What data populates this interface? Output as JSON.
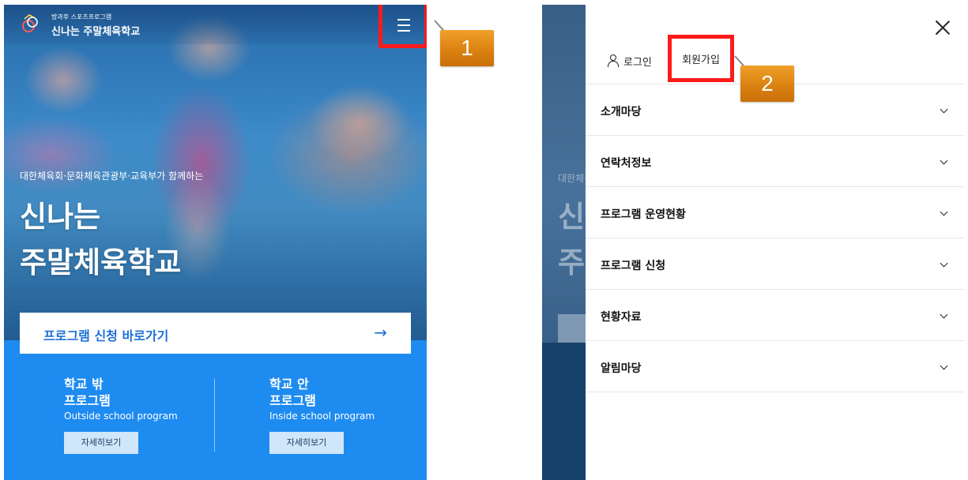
{
  "left": {
    "header": {
      "logo_small": "방과후 스포츠프로그램",
      "logo_title": "신나는 주말체육학교"
    },
    "hero": {
      "subtitle": "대한체육회·문화체육관광부·교육부가 함께하는",
      "title_line1": "신나는",
      "title_line2": "주말체육학교"
    },
    "apply_bar": {
      "label": "프로그램 신청 바로가기",
      "arrow": "→"
    },
    "programs": [
      {
        "title_line1": "학교 밖",
        "title_line2": "프로그램",
        "english": "Outside school program",
        "button": "자세히보기"
      },
      {
        "title_line1": "학교 안",
        "title_line2": "프로그램",
        "english": "Inside school program",
        "button": "자세히보기"
      }
    ]
  },
  "callouts": {
    "one": "1",
    "two": "2"
  },
  "right": {
    "ghost_subtitle": "대한체육회",
    "ghost_title_line1": "신나",
    "ghost_title_line2": "주말",
    "login": "로그인",
    "signup": "회원가입",
    "menu": [
      {
        "label": "소개마당"
      },
      {
        "label": "연락처정보"
      },
      {
        "label": "프로그램 운영현황"
      },
      {
        "label": "프로그램 신청"
      },
      {
        "label": "현황자료"
      },
      {
        "label": "알림마당"
      }
    ]
  },
  "colors": {
    "accent_blue": "#1e8bf0",
    "highlight_red": "#ff1a1a",
    "callout_orange": "#e08a18"
  },
  "icons": {
    "menu": "hamburger-icon",
    "close": "close-icon",
    "user": "person-icon",
    "expand": "chevron-down-icon",
    "go": "arrow-right-icon"
  }
}
